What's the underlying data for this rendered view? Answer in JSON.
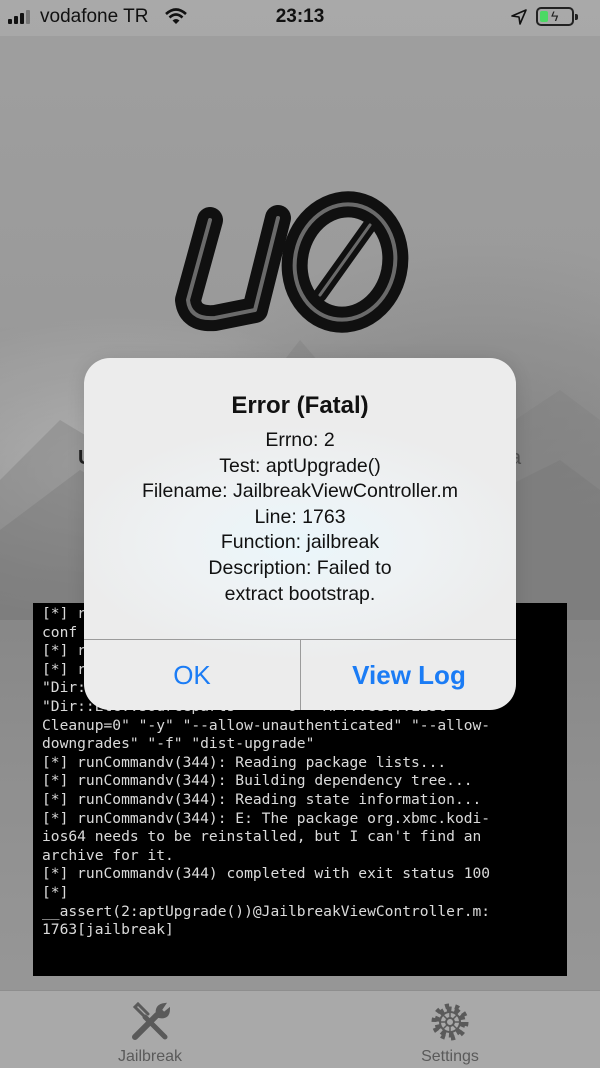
{
  "status_bar": {
    "carrier": "vodafone TR",
    "time": "23:13",
    "battery_level": 0.25,
    "icons": [
      "signal-bars-icon",
      "wifi-icon",
      "location-arrow-icon",
      "battery-charging-icon"
    ]
  },
  "background": {
    "partial_text_left": "U",
    "partial_text_right": "a"
  },
  "alert": {
    "title": "Error (Fatal)",
    "message_lines": [
      "Errno: 2",
      "Test: aptUpgrade()",
      "Filename: JailbreakViewController.m",
      "Line: 1763",
      "Function: jailbreak",
      "Description: Failed to",
      "extract bootstrap."
    ],
    "buttons": {
      "ok": "OK",
      "view_log": "View Log"
    },
    "button_color": "#1b7cf5"
  },
  "terminal": {
    "lines": [
      "[*] r                                     --",
      "conf",
      "[*] r",
      "[*] r                                      o\"",
      "\"Dir:                                    -o\"",
      "\"Dir::Etc::sourceparts=-\" \"-o\" \"APT::Get::List-",
      "Cleanup=0\" \"-y\" \"--allow-unauthenticated\" \"--allow-",
      "downgrades\" \"-f\" \"dist-upgrade\"",
      "[*] runCommandv(344): Reading package lists...",
      "[*] runCommandv(344): Building dependency tree...",
      "[*] runCommandv(344): Reading state information...",
      "[*] runCommandv(344): E: The package org.xbmc.kodi-",
      "ios64 needs to be reinstalled, but I can't find an",
      "archive for it.",
      "[*] runCommandv(344) completed with exit status 100",
      "[*]",
      "__assert(2:aptUpgrade())@JailbreakViewController.m:",
      "1763[jailbreak]"
    ]
  },
  "tab_bar": {
    "tabs": [
      {
        "label": "Jailbreak",
        "icon": "wrench-screwdriver-icon"
      },
      {
        "label": "Settings",
        "icon": "gear-icon"
      }
    ]
  }
}
